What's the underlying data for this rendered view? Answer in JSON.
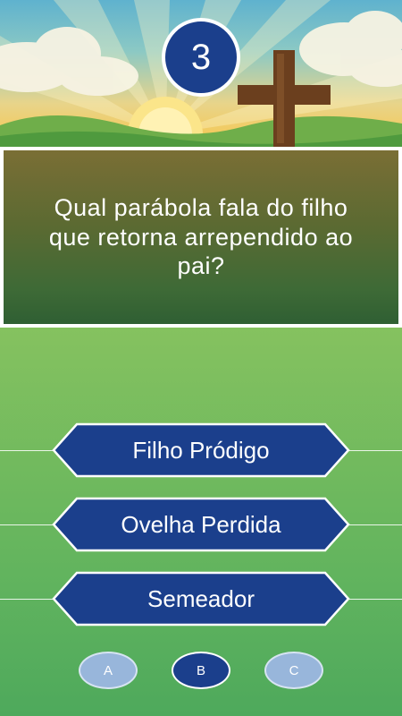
{
  "counter": {
    "value": "3"
  },
  "question": {
    "text": "Qual parábola fala do filho que retorna arrependido ao pai?"
  },
  "answers": [
    {
      "label": "Filho Pródigo"
    },
    {
      "label": "Ovelha Perdida"
    },
    {
      "label": "Semeador"
    }
  ],
  "choices": [
    {
      "label": "A",
      "selected": false
    },
    {
      "label": "B",
      "selected": true
    },
    {
      "label": "C",
      "selected": false
    }
  ],
  "colors": {
    "button_fill": "#1b3f8c",
    "button_border": "#ffffff",
    "choice_idle": "#98b6db",
    "question_bg": "#4f6a33"
  },
  "icons": {
    "hero": "cross-sunrise-illustration"
  }
}
